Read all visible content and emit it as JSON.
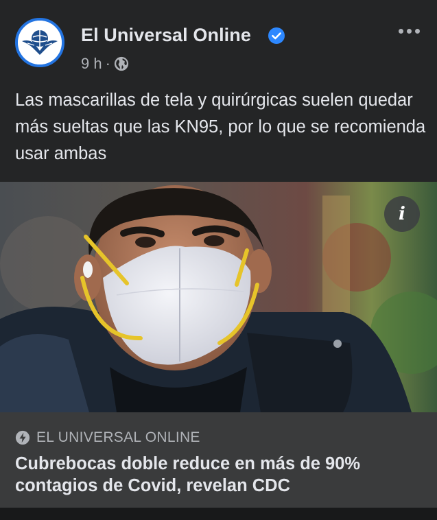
{
  "post": {
    "page_name": "El Universal Online",
    "time": "9 h",
    "separator": "·",
    "text": "Las mascarillas de tela y quirúrgicas suelen quedar más sueltas que las KN95, por lo que se recomienda usar ambas",
    "icons": {
      "verified": "verified-badge-icon",
      "audience": "globe-icon",
      "more": "more-options-icon",
      "info": "info-icon",
      "source": "instant-article-bolt-icon"
    },
    "info_label": "i"
  },
  "link_preview": {
    "source": "EL UNIVERSAL ONLINE",
    "headline": "Cubrebocas doble reduce en más de 90% contagios de Covid, revelan CDC"
  },
  "colors": {
    "background": "#242526",
    "link_box": "#3a3b3c",
    "verified": "#2d88ff",
    "text": "#e4e6eb",
    "secondary_text": "#b0b3b8"
  }
}
